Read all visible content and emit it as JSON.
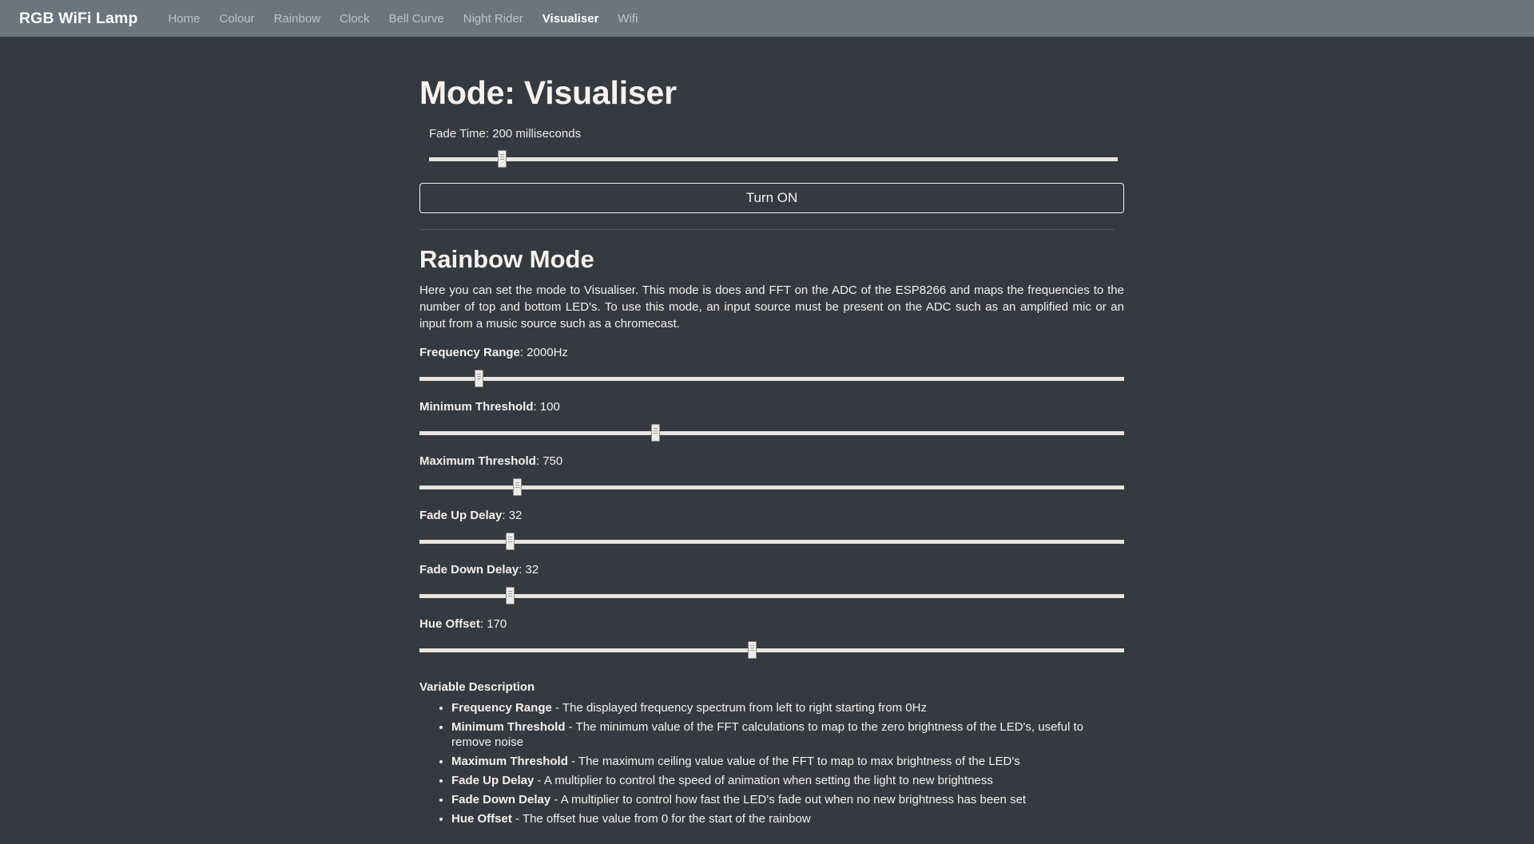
{
  "navbar": {
    "brand": "RGB WiFi Lamp",
    "items": [
      {
        "label": "Home",
        "active": false
      },
      {
        "label": "Colour",
        "active": false
      },
      {
        "label": "Rainbow",
        "active": false
      },
      {
        "label": "Clock",
        "active": false
      },
      {
        "label": "Bell Curve",
        "active": false
      },
      {
        "label": "Night Rider",
        "active": false
      },
      {
        "label": "Visualiser",
        "active": true
      },
      {
        "label": "Wifi",
        "active": false
      }
    ],
    "background": "#6c757d"
  },
  "page": {
    "background": "#343a40",
    "text_color": "#f8f2ee"
  },
  "mode": {
    "title": "Mode: Visualiser",
    "fade_time_label": "Fade Time: 200 milliseconds",
    "fade_time_value": 200,
    "fade_time_percent": 10.5,
    "toggle_button": "Turn ON"
  },
  "section": {
    "title": "Rainbow Mode",
    "description": "Here you can set the mode to Visualiser. This mode is does and FFT on the ADC of the ESP8266 and maps the frequencies to the number of top and bottom LED's. To use this mode, an input source must be present on the ADC such as an amplified mic or an input from a music source such as a chromecast."
  },
  "sliders": [
    {
      "name": "frequency-range",
      "label": "Frequency Range",
      "value": "2000Hz",
      "percent": 8.4
    },
    {
      "name": "minimum-threshold",
      "label": "Minimum Threshold",
      "value": "100",
      "percent": 33.5
    },
    {
      "name": "maximum-threshold",
      "label": "Maximum Threshold",
      "value": "750",
      "percent": 13.8
    },
    {
      "name": "fade-up-delay",
      "label": "Fade Up Delay",
      "value": "32",
      "percent": 12.8
    },
    {
      "name": "fade-down-delay",
      "label": "Fade Down Delay",
      "value": "32",
      "percent": 12.8
    },
    {
      "name": "hue-offset",
      "label": "Hue Offset",
      "value": "170",
      "percent": 47.2
    }
  ],
  "variable_description": {
    "title": "Variable Description",
    "items": [
      {
        "term": "Frequency Range",
        "text": " - The displayed frequency spectrum from left to right starting from 0Hz"
      },
      {
        "term": "Minimum Threshold",
        "text": " - The minimum value of the FFT calculations to map to the zero brightness of the LED's, useful to remove noise"
      },
      {
        "term": "Maximum Threshold",
        "text": " - The maximum ceiling value value of the FFT to map to max brightness of the LED's"
      },
      {
        "term": "Fade Up Delay",
        "text": " - A multiplier to control the speed of animation when setting the light to new brightness"
      },
      {
        "term": "Fade Down Delay",
        "text": " - A multiplier to control how fast the LED's fade out when no new brightness has been set"
      },
      {
        "term": "Hue Offset",
        "text": " - The offset hue value from 0 for the start of the rainbow"
      }
    ]
  }
}
